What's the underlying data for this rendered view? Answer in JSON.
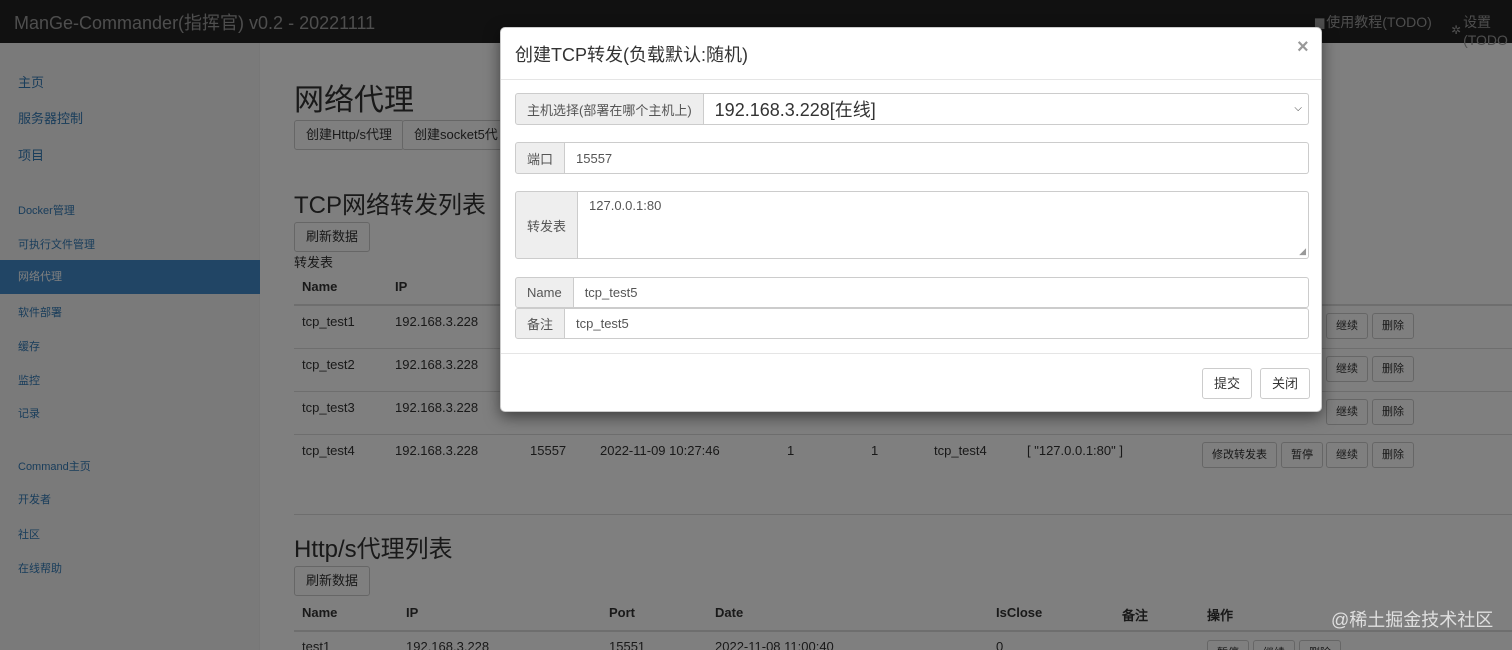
{
  "navbar": {
    "brand": "ManGe-Commander(指挥官) v0.2 - 20221111",
    "help": "使用教程(TODO)",
    "settings": "设置(TODO"
  },
  "sidebar": {
    "top_items": [
      "主页",
      "服务器控制",
      "项目"
    ],
    "mid_items": [
      "Docker管理",
      "可执行文件管理",
      "网络代理",
      "软件部署",
      "缓存",
      "监控",
      "记录"
    ],
    "bottom_items": [
      "Command主页",
      "开发者",
      "社区",
      "在线帮助"
    ],
    "active": "网络代理"
  },
  "main": {
    "title": "网络代理",
    "create_buttons": [
      "创建Http/s代理",
      "创建socket5代"
    ],
    "tcp_section": {
      "title": "TCP网络转发列表",
      "refresh": "刷新数据",
      "caption": "转发表",
      "headers": [
        "Name",
        "IP"
      ],
      "rows": [
        {
          "name": "tcp_test1",
          "ip": "192.168.3.228"
        },
        {
          "name": "tcp_test2",
          "ip": "192.168.3.228"
        },
        {
          "name": "tcp_test3",
          "ip": "192.168.3.228"
        },
        {
          "name": "tcp_test4",
          "ip": "192.168.3.228",
          "port": "15557",
          "date": "2022-11-09 10:27:46",
          "c1": "1",
          "c2": "1",
          "remark": "tcp_test4",
          "table": "[ \"127.0.0.1:80\" ]"
        }
      ],
      "row_actions": {
        "edit": "修改转发表",
        "pause": "暂停",
        "resume": "继续",
        "delete": "删除"
      }
    },
    "http_section": {
      "title": "Http/s代理列表",
      "refresh": "刷新数据",
      "headers": [
        "Name",
        "IP",
        "Port",
        "Date",
        "IsClose",
        "备注",
        "操作"
      ],
      "row": {
        "name": "test1",
        "ip": "192.168.3.228",
        "port": "15551",
        "date": "2022-11-08 11:00:40",
        "isclose": "0"
      },
      "row_actions": {
        "pause": "暂停",
        "resume": "继续",
        "delete": "删除"
      }
    }
  },
  "modal": {
    "title": "创建TCP转发(负载默认:随机)",
    "close_glyph": "×",
    "host_label": "主机选择(部署在哪个主机上)",
    "host_value": "192.168.3.228[在线]",
    "port_label": "端口",
    "port_value": "15557",
    "table_label": "转发表",
    "table_value": "127.0.0.1:80",
    "name_label": "Name",
    "name_value": "tcp_test5",
    "remark_label": "备注",
    "remark_value": "tcp_test5",
    "submit": "提交",
    "close": "关闭"
  },
  "watermark": "@稀土掘金技术社区"
}
